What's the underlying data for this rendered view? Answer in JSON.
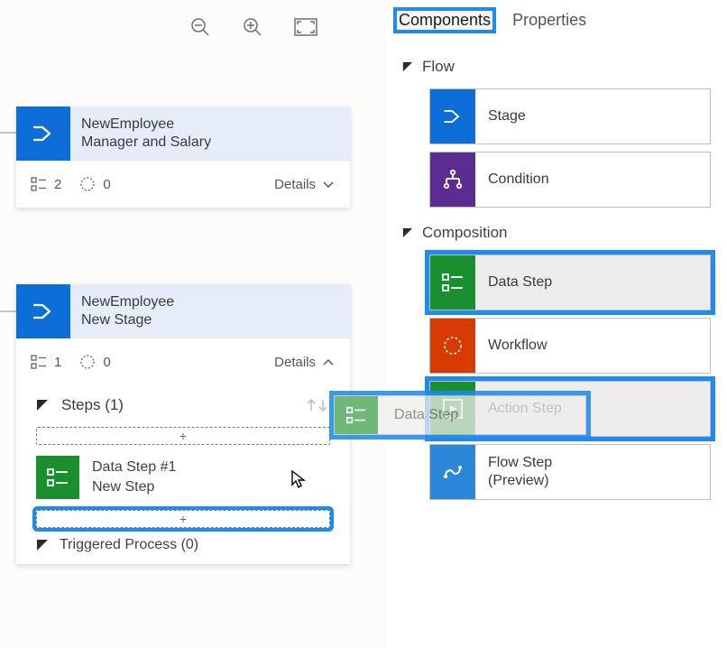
{
  "tabs": {
    "components": "Components",
    "properties": "Properties"
  },
  "sections": {
    "flow": "Flow",
    "composition": "Composition"
  },
  "components": {
    "stage": "Stage",
    "condition": "Condition",
    "datastep": "Data Step",
    "workflow": "Workflow",
    "actionstep": "Action Step",
    "flowstep_line1": "Flow Step",
    "flowstep_line2": "(Preview)"
  },
  "drag": {
    "label": "Data Step"
  },
  "cardA": {
    "title": "NewEmployee",
    "subtitle": "Manager and Salary",
    "steps_count": "2",
    "triggers_count": "0",
    "details": "Details"
  },
  "cardB": {
    "title": "NewEmployee",
    "subtitle": "New Stage",
    "steps_count": "1",
    "triggers_count": "0",
    "details": "Details",
    "steps_label": "Steps (1)",
    "step1_title": "Data Step #1",
    "step1_sub": "New Step",
    "slot_plus": "+",
    "triggered": "Triggered Process (0)"
  }
}
